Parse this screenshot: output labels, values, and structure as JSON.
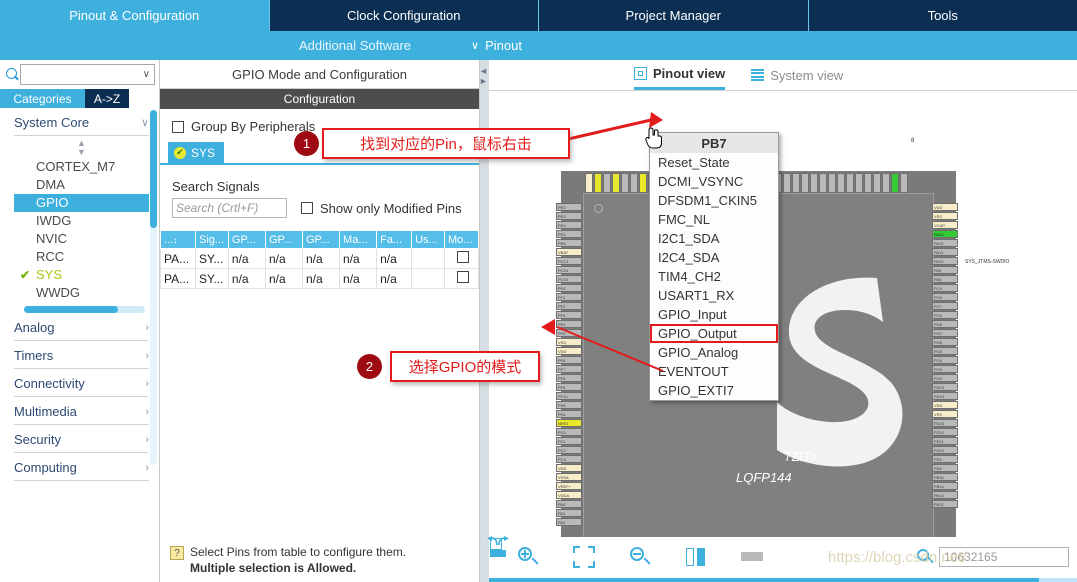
{
  "topnav": {
    "tabs": [
      {
        "label": "Pinout & Configuration",
        "active": true
      },
      {
        "label": "Clock Configuration",
        "active": false
      },
      {
        "label": "Project Manager",
        "active": false
      },
      {
        "label": "Tools",
        "active": false
      }
    ]
  },
  "subnav": {
    "additional_software": "Additional Software",
    "pinout": "Pinout",
    "chevron": "∨"
  },
  "sidebar": {
    "search_value": "",
    "search_arrow": "∨",
    "tabs": [
      {
        "label": "Categories",
        "active": true
      },
      {
        "label": "A->Z",
        "active": false
      }
    ],
    "groups": [
      {
        "label": "System Core",
        "chevron": "∨",
        "expanded": true,
        "items": [
          {
            "label": "CORTEX_M7",
            "selected": false,
            "checked": false
          },
          {
            "label": "DMA",
            "selected": false,
            "checked": false
          },
          {
            "label": "GPIO",
            "selected": true,
            "checked": false
          },
          {
            "label": "IWDG",
            "selected": false,
            "checked": false
          },
          {
            "label": "NVIC",
            "selected": false,
            "checked": false
          },
          {
            "label": "RCC",
            "selected": false,
            "checked": false
          },
          {
            "label": "SYS",
            "selected": false,
            "checked": true
          },
          {
            "label": "WWDG",
            "selected": false,
            "checked": false
          }
        ]
      },
      {
        "label": "Analog",
        "chevron": "›",
        "expanded": false,
        "items": []
      },
      {
        "label": "Timers",
        "chevron": "›",
        "expanded": false,
        "items": []
      },
      {
        "label": "Connectivity",
        "chevron": "›",
        "expanded": false,
        "items": []
      },
      {
        "label": "Multimedia",
        "chevron": "›",
        "expanded": false,
        "items": []
      },
      {
        "label": "Security",
        "chevron": "›",
        "expanded": false,
        "items": []
      },
      {
        "label": "Computing",
        "chevron": "›",
        "expanded": false,
        "items": []
      }
    ],
    "checkmark": "✔"
  },
  "config": {
    "title": "GPIO Mode and Configuration",
    "section_header": "Configuration",
    "group_by_label": "Group By Peripherals",
    "group_by_checked": false,
    "peripheral_tab": "SYS",
    "peripheral_tab_icon": "✔",
    "search_signals_label": "Search Signals",
    "search_placeholder": "Search (Crtl+F)",
    "search_value": "",
    "show_modified_label": "Show only Modified Pins",
    "show_modified_checked": false,
    "table": {
      "headers": [
        "...",
        "Sig...",
        "GP...",
        "GP...",
        "GP...",
        "Ma...",
        "Fa...",
        "Us...",
        "Mo..."
      ],
      "sort_mark": "↕",
      "rows": [
        {
          "cells": [
            "PA...",
            "SY...",
            "n/a",
            "n/a",
            "n/a",
            "n/a",
            "n/a",
            "",
            ""
          ],
          "modified": false
        },
        {
          "cells": [
            "PA...",
            "SY...",
            "n/a",
            "n/a",
            "n/a",
            "n/a",
            "n/a",
            "",
            ""
          ],
          "modified": false
        }
      ]
    },
    "hint_line1": "Select Pins from table to configure them.",
    "hint_line2": "Multiple selection is Allowed.",
    "hint_icon": "?"
  },
  "pinout": {
    "view_tabs": [
      {
        "label": "Pinout view",
        "active": true,
        "icon": "chip-icon"
      },
      {
        "label": "System view",
        "active": false,
        "icon": "list-icon"
      }
    ],
    "chip": {
      "part_name": "7ZITx",
      "package": "LQFP144",
      "signal_note": "SYS_JTMS-SWDIO",
      "corner_label": "8"
    },
    "context_menu": {
      "title": "PB7",
      "items": [
        {
          "label": "Reset_State",
          "highlighted": false
        },
        {
          "label": "DCMI_VSYNC",
          "highlighted": false
        },
        {
          "label": "DFSDM1_CKIN5",
          "highlighted": false
        },
        {
          "label": "FMC_NL",
          "highlighted": false
        },
        {
          "label": "I2C1_SDA",
          "highlighted": false
        },
        {
          "label": "I2C4_SDA",
          "highlighted": false
        },
        {
          "label": "TIM4_CH2",
          "highlighted": false
        },
        {
          "label": "USART1_RX",
          "highlighted": false
        },
        {
          "label": "GPIO_Input",
          "highlighted": false
        },
        {
          "label": "GPIO_Output",
          "highlighted": true
        },
        {
          "label": "GPIO_Analog",
          "highlighted": false
        },
        {
          "label": "EVENTOUT",
          "highlighted": false
        },
        {
          "label": "GPIO_EXTI7",
          "highlighted": false
        }
      ]
    },
    "left_pins": [
      "PE2",
      "PE3",
      "PE4",
      "PE5",
      "PE6",
      "VBAT",
      "PC13",
      "PC14",
      "PC15",
      "PF0",
      "PF1",
      "PF2",
      "PF3",
      "PF4",
      "PF5",
      "VSS",
      "VDD",
      "PF6",
      "PF7",
      "PF8",
      "PF9",
      "PF10",
      "PH0",
      "PH1",
      "NRST",
      "PC0",
      "PC1",
      "PC2",
      "PC3",
      "VDD",
      "VSSA",
      "VREF+",
      "VDDA",
      "PA0",
      "PA1",
      "PA2"
    ],
    "right_pins": [
      "VDD",
      "VSS",
      "VCAP.",
      "PA13",
      "PA12",
      "PA11",
      "PA10",
      "PA9",
      "PA8",
      "PC9",
      "PC8",
      "PC7",
      "PC6",
      "PG8",
      "PG7",
      "PG6",
      "PG5",
      "PG4",
      "PG3",
      "PG2",
      "PD15",
      "PD14",
      "VDD",
      "VSS",
      "PD13",
      "PD12",
      "PD11",
      "PD10",
      "PD9",
      "PD8",
      "PB15",
      "PB14",
      "PB13",
      "PB12"
    ],
    "toolbar": [
      {
        "name": "zoom-in-button",
        "icon": "zoom-in-icon"
      },
      {
        "name": "fit-to-screen-button",
        "icon": "fit-icon"
      },
      {
        "name": "zoom-out-button",
        "icon": "zoom-out-icon"
      },
      {
        "name": "rotate-right-button",
        "icon": "rotate-right-icon"
      },
      {
        "name": "rotate-left-button",
        "icon": "rotate-left-icon"
      },
      {
        "name": "flip-vertical-button",
        "icon": "flip-vertical-icon"
      },
      {
        "name": "keyboard-button",
        "icon": "keyboard-icon"
      }
    ],
    "search_value": "10632165"
  },
  "annotations": [
    {
      "number": "1",
      "text": "找到对应的Pin，鼠标右击"
    },
    {
      "number": "2",
      "text": "选择GPIO的模式"
    }
  ],
  "watermark": "https://blog.csdn.net/",
  "colors": {
    "accent": "#3eb0de",
    "navy": "#0b2e53",
    "annotation_red": "#e31b1b",
    "badge_red": "#9e0b12",
    "pin_active_green": "#33cc33",
    "pin_highlight_yellow": "#e8e82a",
    "pin_power": "#f7edc8"
  }
}
